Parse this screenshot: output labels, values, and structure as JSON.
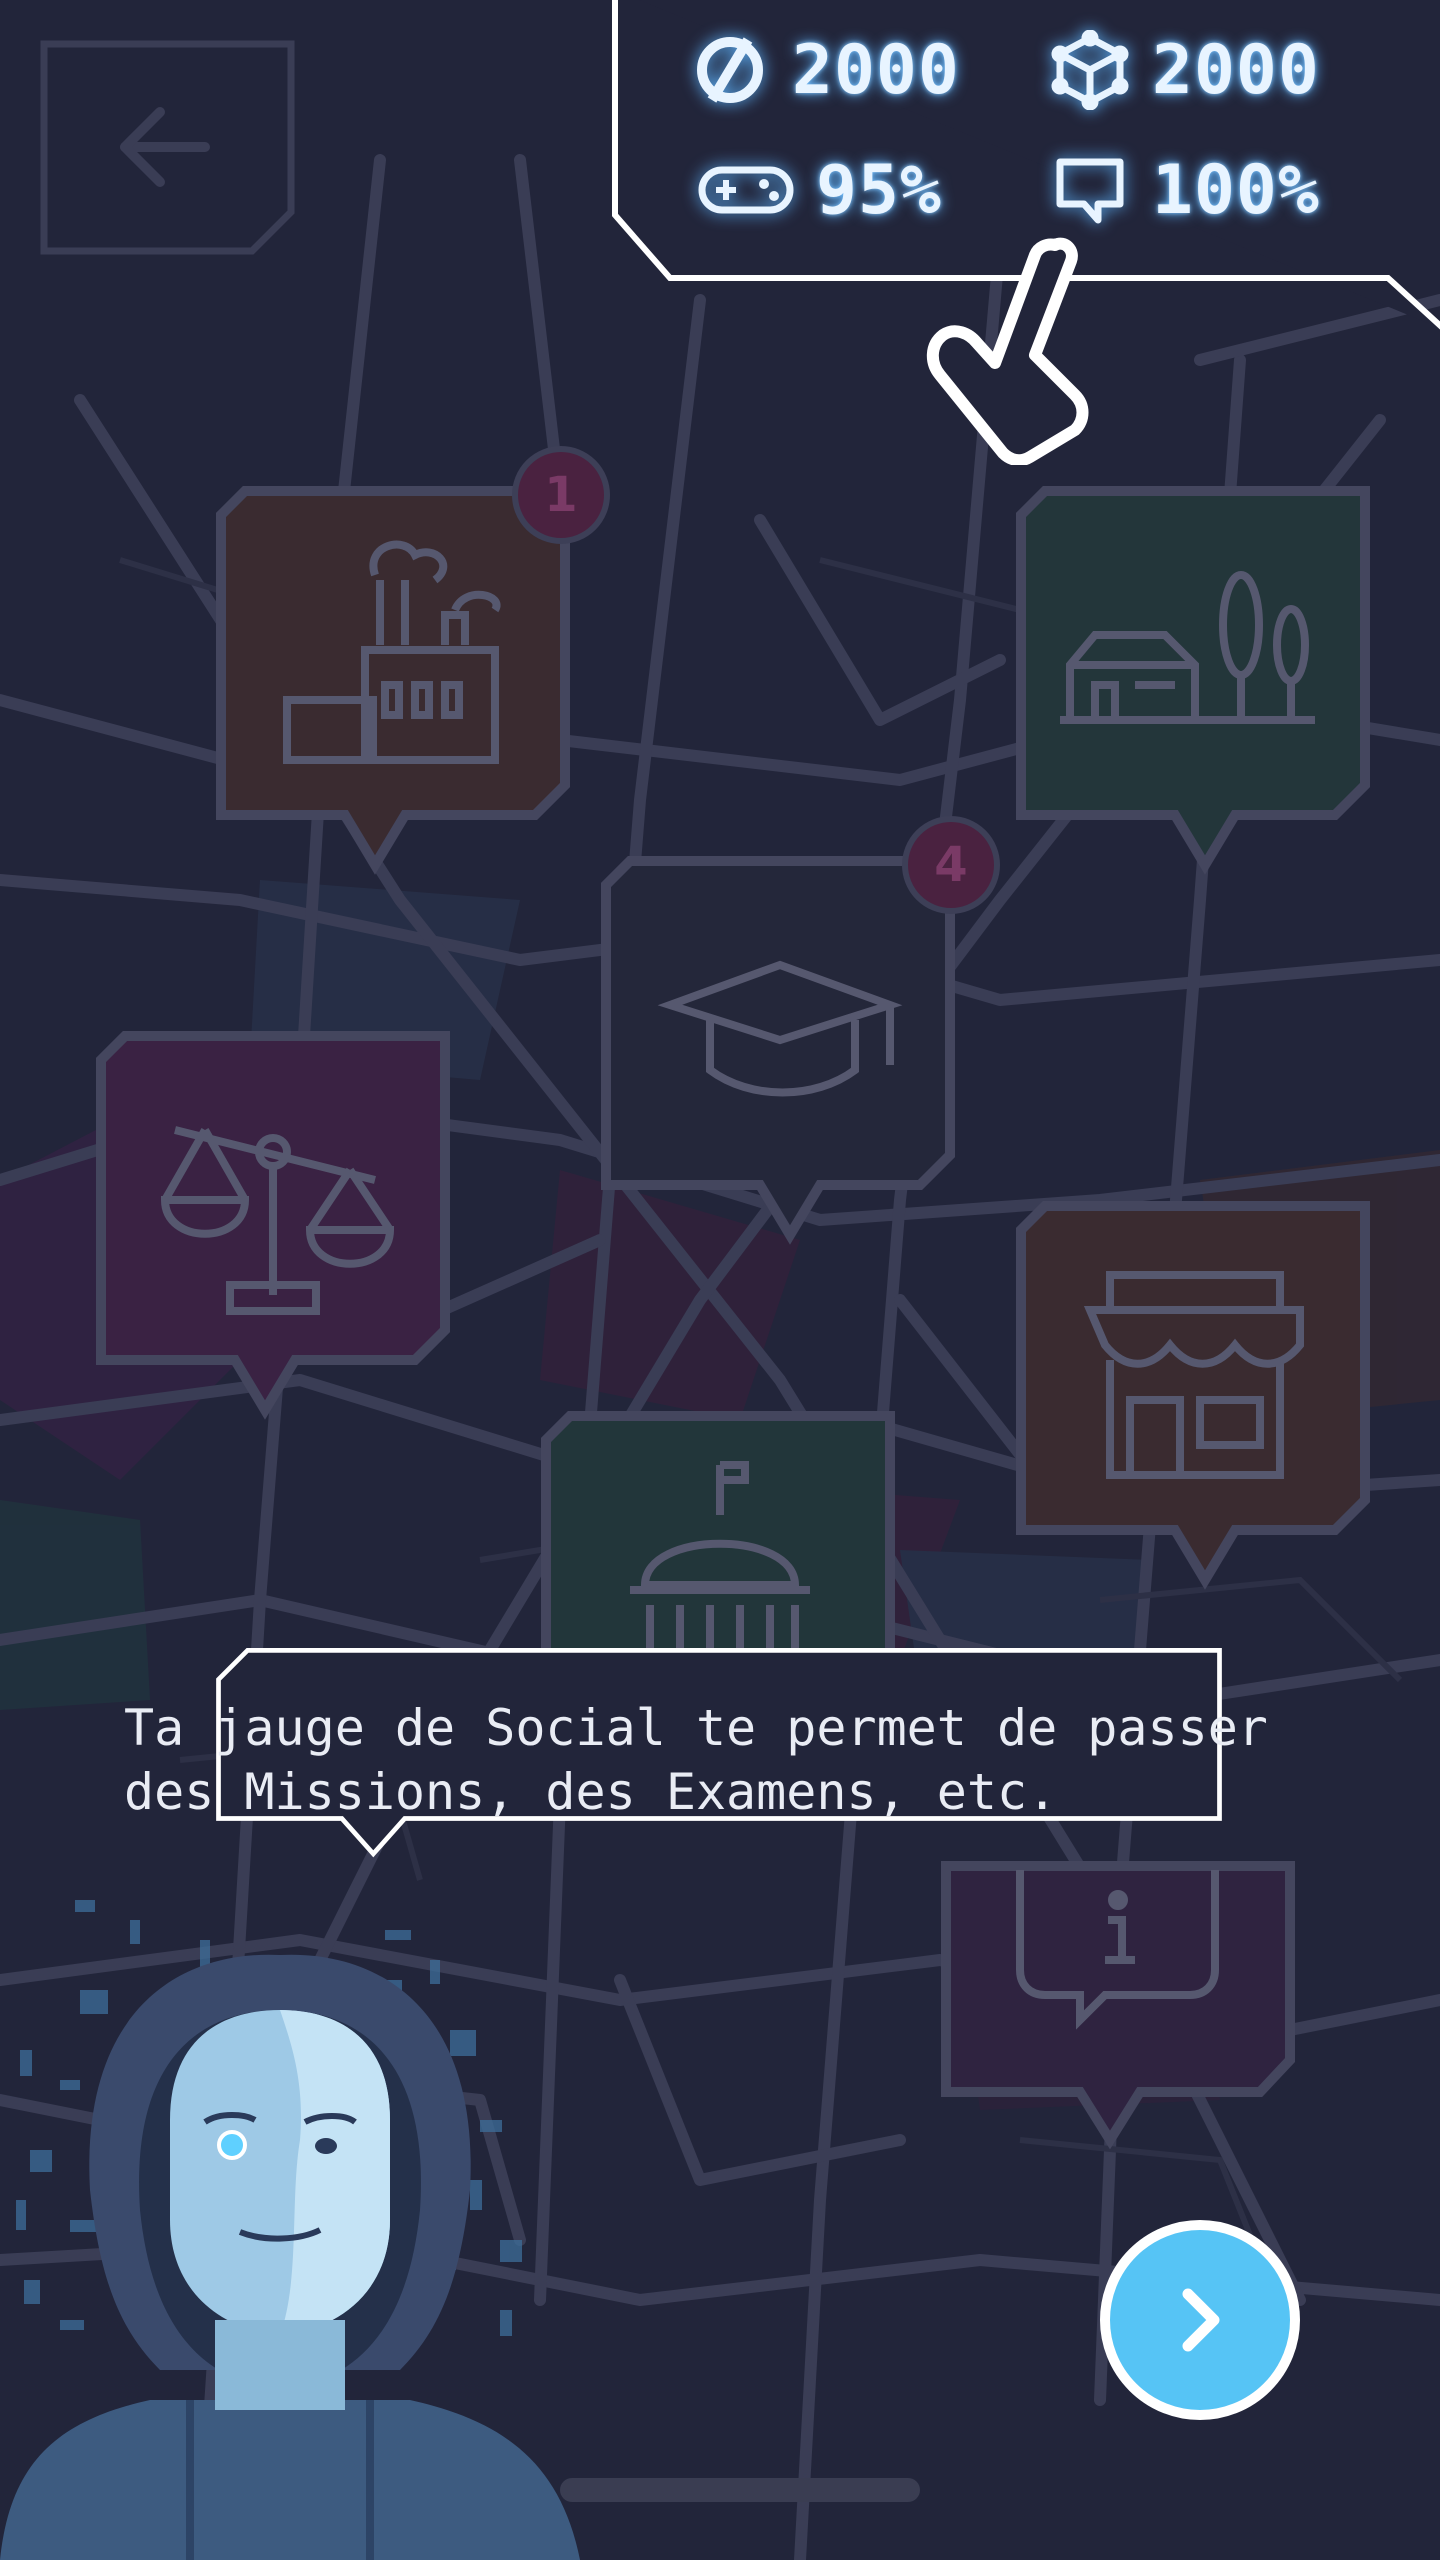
{
  "hud": {
    "coins": {
      "icon": "coin-icon",
      "value": "2000"
    },
    "cubes": {
      "icon": "cube-icon",
      "value": "2000"
    },
    "fun": {
      "icon": "gamepad-icon",
      "value": "95%"
    },
    "social": {
      "icon": "speech-bubble-icon",
      "value": "100%"
    }
  },
  "pins": [
    {
      "name": "factory",
      "icon": "factory-icon",
      "badge": "1"
    },
    {
      "name": "houses",
      "icon": "house-trees-icon",
      "badge": ""
    },
    {
      "name": "school",
      "icon": "graduation-cap-icon",
      "badge": "4"
    },
    {
      "name": "justice",
      "icon": "scales-icon",
      "badge": ""
    },
    {
      "name": "shop",
      "icon": "shop-icon",
      "badge": ""
    },
    {
      "name": "government",
      "icon": "capitol-icon",
      "badge": ""
    },
    {
      "name": "info",
      "icon": "info-icon",
      "badge": ""
    }
  ],
  "dialog": {
    "text": "Ta jauge de Social te permet de passer\ndes Missions, des Examens, etc."
  },
  "colors": {
    "background": "#22253a",
    "accent": "#56c4f5",
    "glow": "#5fb6ff"
  }
}
